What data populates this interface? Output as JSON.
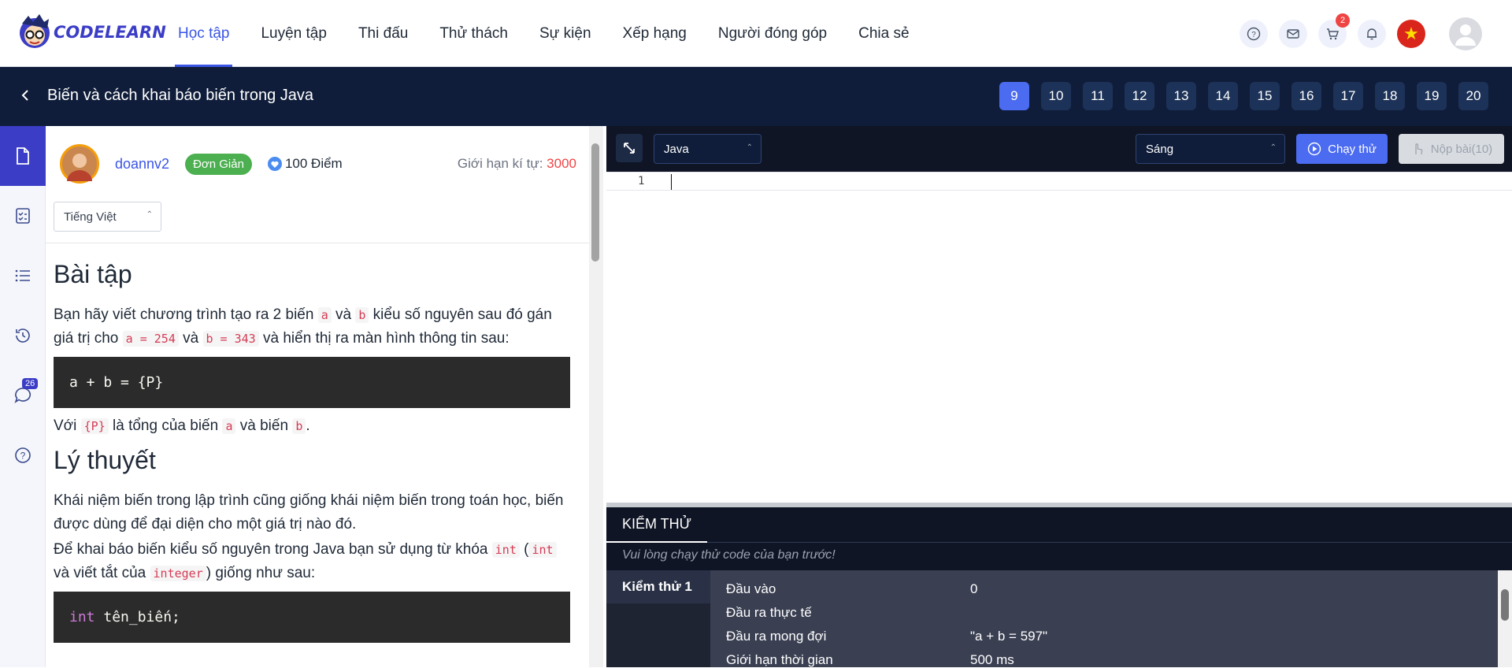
{
  "brand": {
    "name": "CODELEARN"
  },
  "nav": {
    "items": [
      "Học tập",
      "Luyện tập",
      "Thi đấu",
      "Thử thách",
      "Sự kiện",
      "Xếp hạng",
      "Người đóng góp",
      "Chia sẻ"
    ],
    "active_index": 0,
    "cart_count": "2"
  },
  "lesson": {
    "title": "Biến và cách khai báo biến trong Java",
    "pages": [
      "9",
      "10",
      "11",
      "12",
      "13",
      "14",
      "15",
      "16",
      "17",
      "18",
      "19",
      "20"
    ],
    "active_page": "9"
  },
  "sidebar": {
    "chat_badge": "26"
  },
  "problem": {
    "username": "doannv2",
    "difficulty": "Đơn Giản",
    "points": "100 Điểm",
    "limit_label": "Giới hạn kí tự:",
    "limit_value": "3000",
    "language": "Tiếng Việt",
    "heading_exercise": "Bài tập",
    "para1_a": "Bạn hãy viết chương trình tạo ra 2 biến ",
    "code_a": "a",
    "para1_b": " và ",
    "code_b": "b",
    "para1_c": " kiểu số nguyên sau đó gán giá trị cho ",
    "code_a254": "a = 254",
    "para1_d": " và ",
    "code_b343": "b = 343",
    "para1_e": " và hiển thị ra màn hình thông tin sau:",
    "codeblock1": "a + b = {P}",
    "para2_a": "Với ",
    "code_p": "{P}",
    "para2_b": " là tổng của biến ",
    "para2_c": " và biến ",
    "para2_d": ".",
    "heading_theory": "Lý thuyết",
    "para3": "Khái niệm biến trong lập trình cũng giống khái niệm biến trong toán học, biến được dùng để đại diện cho một giá trị nào đó.",
    "para4_a": "Để khai báo biến kiểu số nguyên trong Java bạn sử dụng từ khóa ",
    "code_int": "int",
    "para4_b": "(",
    "para4_c": " và viết tắt của ",
    "code_integer": "integer",
    "para4_d": ") giống như sau:",
    "codeblock2_kw": "int",
    "codeblock2_rest": " tên_biến;"
  },
  "editor": {
    "language": "Java",
    "theme": "Sáng",
    "run_label": "Chạy thử",
    "submit_label": "Nộp bài(10)",
    "line_number": "1"
  },
  "tests": {
    "tab": "KIỂM THỬ",
    "message": "Vui lòng chạy thử code của bạn trước!",
    "case_label": "Kiểm thử 1",
    "rows": [
      {
        "label": "Đầu vào",
        "value": "0"
      },
      {
        "label": "Đầu ra thực tế",
        "value": ""
      },
      {
        "label": "Đầu ra mong đợi",
        "value": "\"a + b = 597\""
      },
      {
        "label": "Giới hạn thời gian",
        "value": "500 ms"
      }
    ]
  }
}
